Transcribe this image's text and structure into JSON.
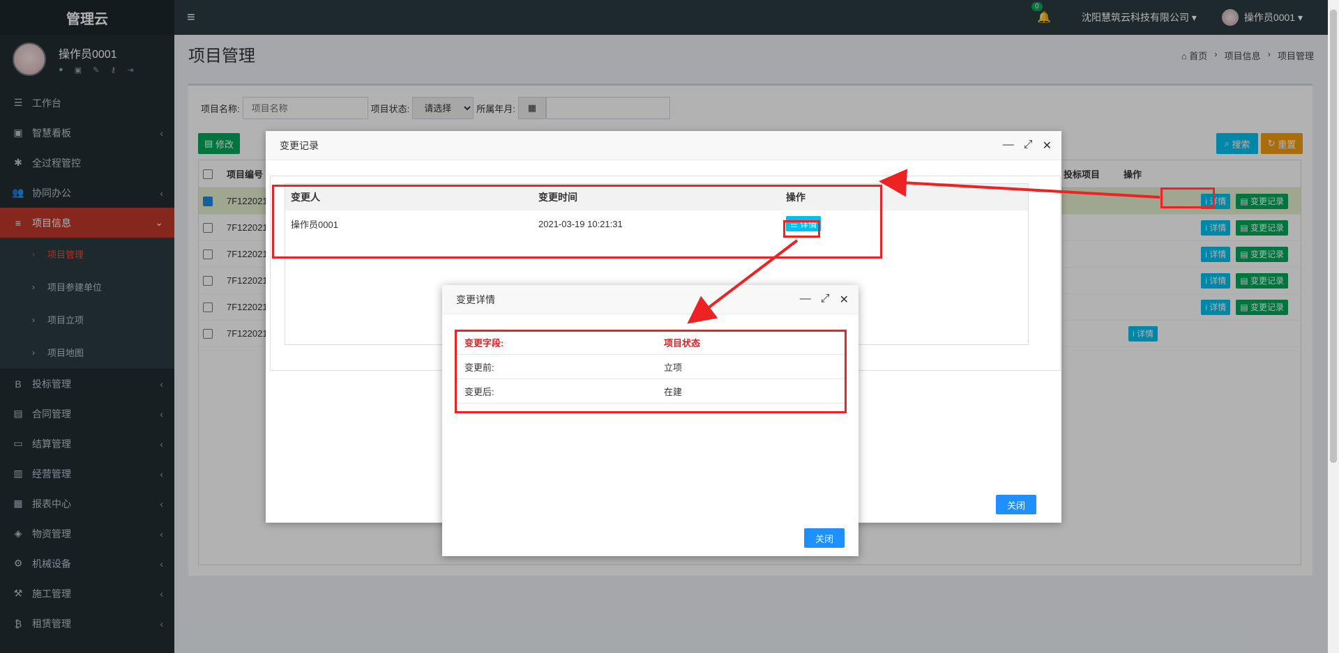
{
  "app": {
    "logo": "管理云"
  },
  "user": {
    "name": "操作员0001",
    "panel_icons": [
      "user-icon",
      "card-icon",
      "edit-icon",
      "key-icon",
      "logout-icon"
    ]
  },
  "header": {
    "notifications": "0",
    "company": "沈阳慧筑云科技有限公司",
    "user_menu": "操作员0001"
  },
  "sidebar": {
    "items": [
      {
        "label": "工作台",
        "icon": "☰",
        "arrow": ""
      },
      {
        "label": "智慧看板",
        "icon": "▣",
        "arrow": "‹"
      },
      {
        "label": "全过程管控",
        "icon": "✱",
        "arrow": ""
      },
      {
        "label": "协同办公",
        "icon": "👥",
        "arrow": "‹"
      },
      {
        "label": "项目信息",
        "icon": "≡",
        "arrow": "⌄"
      }
    ],
    "subitems": [
      {
        "label": "项目管理"
      },
      {
        "label": "项目参建单位"
      },
      {
        "label": "项目立项"
      },
      {
        "label": "项目地图"
      }
    ],
    "items2": [
      {
        "label": "投标管理",
        "icon": "B",
        "arrow": "‹"
      },
      {
        "label": "合同管理",
        "icon": "▤",
        "arrow": "‹"
      },
      {
        "label": "结算管理",
        "icon": "▭",
        "arrow": "‹"
      },
      {
        "label": "经营管理",
        "icon": "▥",
        "arrow": "‹"
      },
      {
        "label": "报表中心",
        "icon": "▦",
        "arrow": "‹"
      },
      {
        "label": "物资管理",
        "icon": "◈",
        "arrow": "‹"
      },
      {
        "label": "机械设备",
        "icon": "⚙",
        "arrow": "‹"
      },
      {
        "label": "施工管理",
        "icon": "⚒",
        "arrow": "‹"
      },
      {
        "label": "租赁管理",
        "icon": "₿",
        "arrow": "‹"
      }
    ]
  },
  "page": {
    "title": "项目管理",
    "breadcrumb": [
      "⌂ 首页",
      "›",
      "项目信息",
      "›",
      "项目管理"
    ]
  },
  "filter": {
    "name_label": "项目名称:",
    "name_placeholder": "项目名称",
    "status_label": "项目状态:",
    "status_value": "请选择",
    "month_label": "所属年月:"
  },
  "toolbar": {
    "edit": "修改",
    "search": "搜索",
    "reset": "重置"
  },
  "table": {
    "header_no": "项目编号",
    "header_bid": "投标项目",
    "header_ops": "操作",
    "rows": [
      {
        "no": "7F122021",
        "checked": true
      },
      {
        "no": "7F122021",
        "checked": false
      },
      {
        "no": "7F122021",
        "checked": false
      },
      {
        "no": "7F122021",
        "checked": false
      },
      {
        "no": "7F122021",
        "checked": false
      },
      {
        "no": "7F122021",
        "checked": false
      }
    ],
    "detail_btn": "i 详情",
    "record_btn": "▤ 变更记录"
  },
  "modal1": {
    "title": "变更记录",
    "columns": [
      "变更人",
      "变更时间",
      "操作"
    ],
    "rows": [
      {
        "person": "操作员0001",
        "time": "2021-03-19 10:21:31",
        "action": "☰ 详情"
      }
    ],
    "close": "关闭"
  },
  "modal2": {
    "title": "变更详情",
    "rows": [
      {
        "k": "变更字段:",
        "v": "项目状态"
      },
      {
        "k": "变更前:",
        "v": "立项"
      },
      {
        "k": "变更后:",
        "v": "在建"
      }
    ],
    "close": "关闭"
  },
  "colors": {
    "sidebar": "#222d32",
    "header": "#2c3b41",
    "active": "#c0392b",
    "annotation": "#ee2222"
  }
}
